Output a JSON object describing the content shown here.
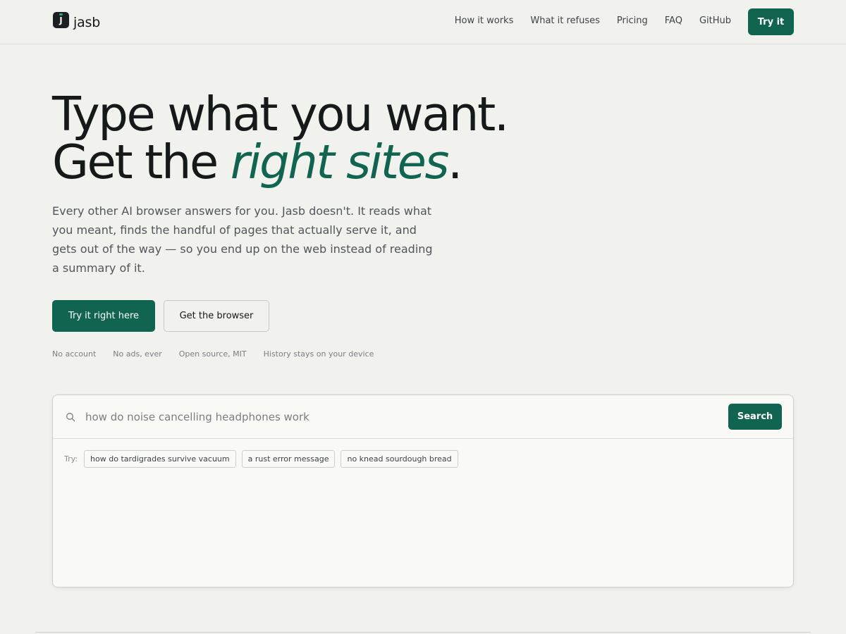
{
  "brand": {
    "name": "jasb",
    "logo_letter": "J"
  },
  "nav": {
    "links": [
      "How it works",
      "What it refuses",
      "Pricing",
      "FAQ",
      "GitHub"
    ],
    "cta": "Try it"
  },
  "hero": {
    "title_line1": "Type what you want.",
    "title_line2_prefix": "Get the ",
    "title_line2_accent": "right sites",
    "title_line2_suffix": ".",
    "subtitle": "Every other AI browser answers for you. Jasb doesn't. It reads what you meant, finds the handful of pages that actually serve it, and gets out of the way — so you end up on the web instead of reading a summary of it.",
    "primary_button": "Try it right here",
    "secondary_button": "Get the browser",
    "features": [
      "No account",
      "No ads, ever",
      "Open source, MIT",
      "History stays on your device"
    ]
  },
  "search": {
    "placeholder": "how do noise cancelling headphones work",
    "button": "Search",
    "try_label": "Try:",
    "suggestions": [
      "how do tardigrades survive vacuum",
      "a rust error message",
      "no knead sourdough bread"
    ]
  },
  "colors": {
    "accent": "#11644f",
    "background": "#f1f1ee",
    "text": "#16191a"
  },
  "icons": {
    "logo": "jasb-logo-icon",
    "search": "search-icon"
  }
}
